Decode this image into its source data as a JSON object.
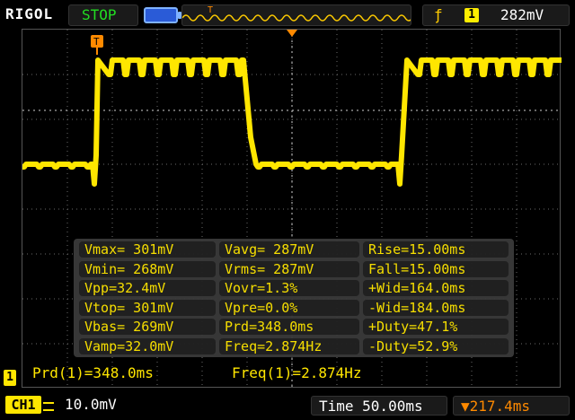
{
  "topbar": {
    "brand": "RIGOL",
    "run_state": "STOP",
    "trigger_icon": "edge-rising-icon",
    "trigger_channel": "1",
    "trigger_level": "282mV"
  },
  "measurements": [
    [
      "Vmax= 301mV",
      "Vavg= 287mV",
      "Rise=15.00ms"
    ],
    [
      "Vmin= 268mV",
      "Vrms= 287mV",
      "Fall=15.00ms"
    ],
    [
      "Vpp=32.4mV",
      "Vovr=1.3%",
      "+Wid=164.0ms"
    ],
    [
      "Vtop= 301mV",
      "Vpre=0.0%",
      "-Wid=184.0ms"
    ],
    [
      "Vbas= 269mV",
      "Prd=348.0ms",
      "+Duty=47.1%"
    ],
    [
      "Vamp=32.0mV",
      "Freq=2.874Hz",
      "-Duty=52.9%"
    ]
  ],
  "bottom_readouts": {
    "prd": "Prd(1)=348.0ms",
    "freq": "Freq(1)=2.874Hz"
  },
  "statusbar": {
    "channel": "CH1",
    "volts_per_div": "10.0mV",
    "timebase": "Time 50.00ms",
    "trigger_offset": "▼217.4ms",
    "left_marker": "1"
  },
  "colors": {
    "trace": "#ffe600",
    "run_state": "#22dd22",
    "offset": "#ff8a00",
    "trigger_marker": "#ff8a00"
  }
}
